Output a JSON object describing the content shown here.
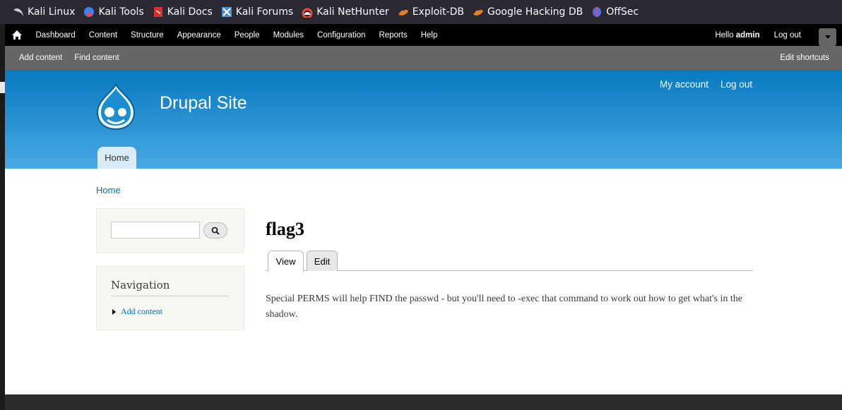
{
  "bookmarks": [
    {
      "label": "Kali Linux",
      "icon": "kali-dragon-icon",
      "color": "#cccccc"
    },
    {
      "label": "Kali Tools",
      "icon": "kali-tools-icon",
      "color": "#3b82f6"
    },
    {
      "label": "Kali Docs",
      "icon": "kali-docs-icon",
      "color": "#d63031"
    },
    {
      "label": "Kali Forums",
      "icon": "kali-forums-icon",
      "color": "#4a90e2"
    },
    {
      "label": "Kali NetHunter",
      "icon": "nethunter-icon",
      "color": "#e74c3c"
    },
    {
      "label": "Exploit-DB",
      "icon": "exploit-db-icon",
      "color": "#e67e22"
    },
    {
      "label": "Google Hacking DB",
      "icon": "ghdb-icon",
      "color": "#e67e22"
    },
    {
      "label": "OffSec",
      "icon": "offsec-icon",
      "color": "#4c6ef5"
    }
  ],
  "toolbar": {
    "menu": [
      "Dashboard",
      "Content",
      "Structure",
      "Appearance",
      "People",
      "Modules",
      "Configuration",
      "Reports",
      "Help"
    ],
    "hello_prefix": "Hello ",
    "user": "admin",
    "logout": "Log out"
  },
  "shortcuts": {
    "items": [
      "Add content",
      "Find content"
    ],
    "edit": "Edit shortcuts"
  },
  "header": {
    "site_name": "Drupal Site",
    "secondary_menu": [
      "My account",
      "Log out"
    ],
    "main_menu": [
      "Home"
    ]
  },
  "breadcrumb": "Home",
  "sidebar": {
    "search_value": "",
    "navigation_title": "Navigation",
    "navigation_links": [
      "Add content"
    ]
  },
  "node": {
    "title": "flag3",
    "tabs": [
      "View",
      "Edit"
    ],
    "body": "Special PERMS will help FIND the passwd - but you'll need to -exec that command to work out how to get what's in the shadow."
  },
  "colors": {
    "header_top": "#0779bf",
    "header_bottom": "#48a9e4",
    "link": "#0071b3"
  }
}
